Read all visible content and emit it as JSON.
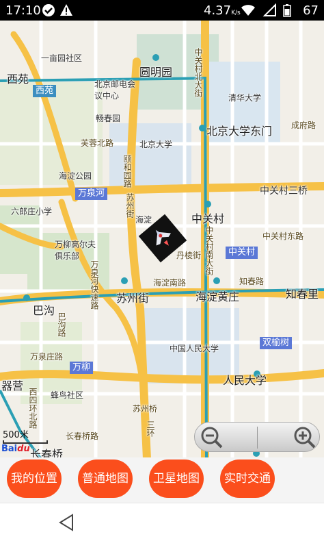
{
  "status": {
    "time": "17:10",
    "speed": "4.37",
    "speed_unit": "K/s",
    "battery": "67"
  },
  "map": {
    "labels": {
      "yimuyuan": "一亩园社区",
      "xiyuan": "西苑",
      "yuanmingyuan": "圆明园",
      "zgc_north": "中关村北大街",
      "qinghua": "清华大学",
      "youdian": "北京邮电会议中心",
      "changchunyuan": "畅春园",
      "pku_east": "北京大学东门",
      "chengfu": "成府路",
      "furong": "芙蓉北路",
      "pku": "北京大学",
      "haidian_park": "海淀公园",
      "yiheyuan_rd": "颐和园路",
      "wanquanhe": "万泉河",
      "zgc_3": "中关村三桥",
      "liulang": "六郎庄小学",
      "suzhou_st_v": "苏州街",
      "haidian_v": "海淀",
      "zgc": "中关村",
      "zgc_south": "中关村南大街",
      "zgc_mid": "中关村",
      "zgc_ne": "中关村东路",
      "wanliu_club": "万柳高尔夫俱乐部",
      "danleng": "丹棱街",
      "haidian_south": "海淀南路",
      "zhichun_rd": "知春路",
      "zhichunli": "知春里",
      "wanquanhe_rd": "万泉河快速路",
      "bagou": "巴沟",
      "suzhou_st": "苏州街",
      "haidian_huangzhuang": "海淀黄庄",
      "wanquan_rd": "万泉庄路",
      "renmin_univ_v": "人民大学",
      "shuangyushu": "双榆树",
      "wanliu": "万柳",
      "ruc_campus": "中国人民大学",
      "renmin_univ": "人民大学",
      "feng_ying": "器营",
      "west_fourth": "西四环北路",
      "fengniao": "蜂鸟社区",
      "suzhou_bridge": "苏州桥",
      "third_ring": "三环",
      "changchun_rd": "长春桥路",
      "changchunqiao": "长春桥",
      "left_yu": "园",
      "bagou_v": "巴沟路"
    },
    "scale_label": "500米",
    "logo_text": "Bai",
    "logo_suffix": "du"
  },
  "buttons": {
    "my_location": "我的位置",
    "normal_map": "普通地图",
    "satellite_map": "卫星地图",
    "traffic": "实时交通"
  },
  "colors": {
    "button": "#fb4e1c",
    "road_major": "#f6c146",
    "subway": "#2b9fb4"
  }
}
